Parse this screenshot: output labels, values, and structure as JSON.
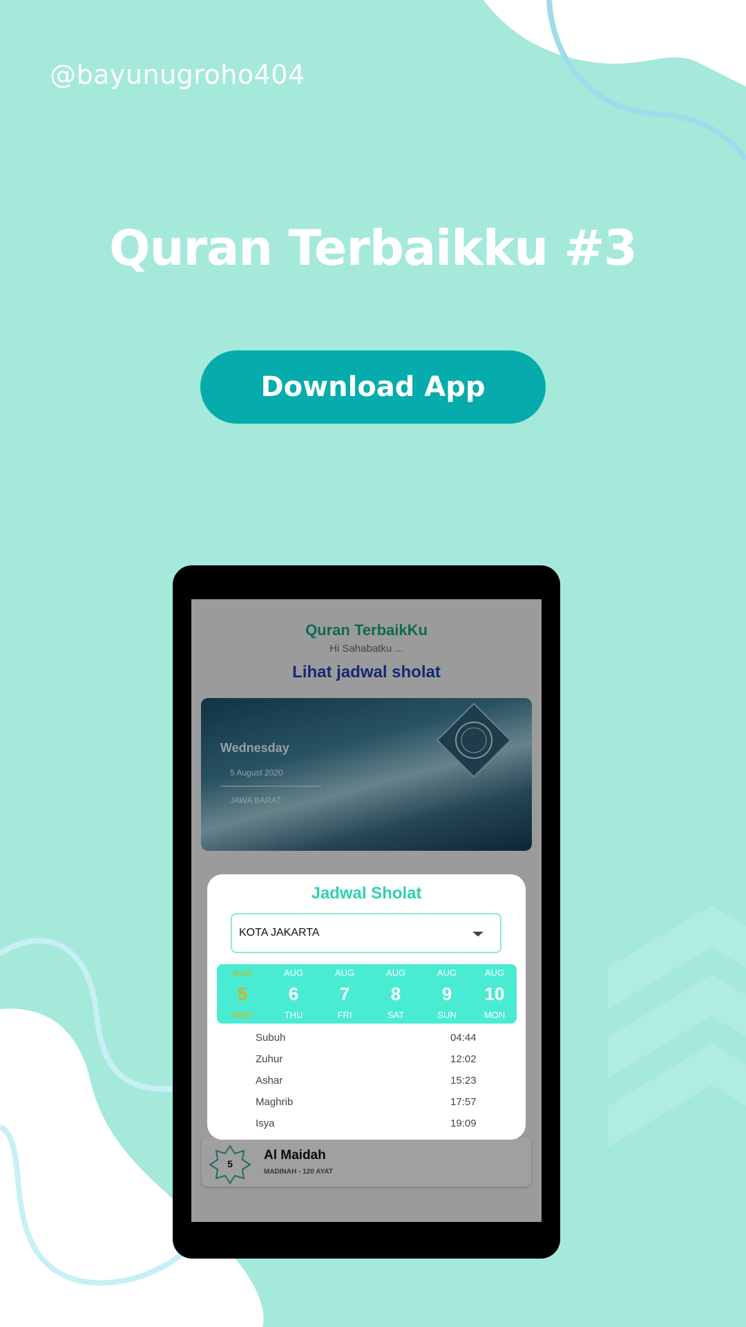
{
  "handle": "@bayunugroho404",
  "title": "Quran Terbaikku #3",
  "download_button": "Download App",
  "app": {
    "title": "Quran TerbaikKu",
    "greeting": "Hi Sahabatku ...",
    "link": "Lihat jadwal sholat",
    "banner": {
      "day": "Wednesday",
      "date": "5 August 2020",
      "region": "JAWA BARAT"
    },
    "surah_card": {
      "number": "5",
      "name": "Al Maidah",
      "meta": "MADINAH - 120 AYAT"
    }
  },
  "dialog": {
    "title": "Jadwal Sholat",
    "city": "KOTA JAKARTA",
    "dates": [
      {
        "month": "AUG",
        "day": "5",
        "weekday": "WED",
        "active": true
      },
      {
        "month": "AUG",
        "day": "6",
        "weekday": "THU",
        "active": false
      },
      {
        "month": "AUG",
        "day": "7",
        "weekday": "FRI",
        "active": false
      },
      {
        "month": "AUG",
        "day": "8",
        "weekday": "SAT",
        "active": false
      },
      {
        "month": "AUG",
        "day": "9",
        "weekday": "SUN",
        "active": false
      },
      {
        "month": "AUG",
        "day": "10",
        "weekday": "MON",
        "active": false
      }
    ],
    "times": [
      {
        "name": "Subuh",
        "time": "04:44"
      },
      {
        "name": "Zuhur",
        "time": "12:02"
      },
      {
        "name": "Ashar",
        "time": "15:23"
      },
      {
        "name": "Maghrib",
        "time": "17:57"
      },
      {
        "name": "Isya",
        "time": "19:09"
      }
    ]
  },
  "colors": {
    "background": "#a5e9db",
    "button": "#05acab",
    "accent": "#2fd1b0",
    "date_strip": "#49ecd2",
    "active_date": "#d2b21c"
  }
}
